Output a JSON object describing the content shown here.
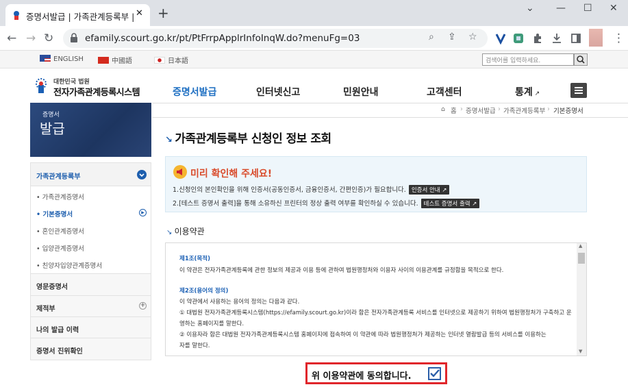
{
  "browser": {
    "tab_title": "증명서발급 | 가족관계등록부 | 진",
    "tab_close": "✕",
    "new_tab": "+",
    "url": "efamily.scourt.go.kr/pt/PtFrrpApplrInfoInqW.do?menuFg=03",
    "window_controls": [
      "⌄",
      "—",
      "☐",
      "✕"
    ]
  },
  "langbar": {
    "english": "ENGLISH",
    "chinese": "中國語",
    "japanese": "日本語",
    "search_placeholder": "검색어를 입력하세요."
  },
  "header": {
    "logo_sub": "대한민국 법원",
    "logo_main": "전자가족관계등록시스템",
    "nav": [
      "증명서발급",
      "인터넷신고",
      "민원안내",
      "고객센터",
      "통계"
    ],
    "active_nav_color": "#1e6fc2"
  },
  "banner": {
    "small": "증명서",
    "big": "발급"
  },
  "breadcrumb": [
    "홈",
    "증명서발급",
    "가족관계등록부",
    "기본증명서"
  ],
  "sidebar": {
    "section": "가족관계등록부",
    "items": [
      "가족관계증명서",
      "기본증명서",
      "혼인관계증명서",
      "입양관계증명서",
      "친양자입양관계증명서"
    ],
    "others": [
      "영문증명서",
      "제적부",
      "나의 발급 이력",
      "증명서 진위확인"
    ]
  },
  "page": {
    "title": "가족관계등록부 신청인 정보 조회",
    "notice_heading": "미리 확인해 주세요!",
    "notice_line1": "1.신청인의 본인확인을 위해 인증서(공동인증서, 금융인증서, 간편인증)가 필요합니다.",
    "notice_btn1": "인증서 안내",
    "notice_line2": "2.[테스트 증명서 출력]을 통해 소유하신 프린터의 정상 출력 여부를 확인하실 수 있습니다.",
    "notice_btn2": "테스트 증명서 출력",
    "terms_heading": "이용약관",
    "terms": [
      {
        "bold": true,
        "text": "제1조(목적)"
      },
      {
        "bold": false,
        "text": "이 약관은 전자가족관계등록에 관한 정보의 제공과 이용 등에 관하여 법원행정처와 이용자 사이의 이용관계를 규정함을 목적으로 한다."
      },
      {
        "bold": true,
        "text": "제2조(용어의 정의)"
      },
      {
        "bold": false,
        "text": "이 약관에서 사용하는 용어의 정의는 다음과 같다."
      },
      {
        "bold": false,
        "text": "① 대법원 전자가족관계등록시스템(https://efamily.scourt.go.kr)이라 함은 전자가족관계등록 서비스를 인터넷으로 제공하기 위하여 법원행정처가 구축하고 운"
      },
      {
        "bold": false,
        "text": "영하는 홈페이지를 말한다."
      },
      {
        "bold": false,
        "text": "② 이용자라 함은 대법원 전자가족관계등록시스템 홈페이지에 접속하여 이 약관에 따라 법원행정처가 제공하는 인터넷 열람발급 등의 서비스를 이용하는"
      },
      {
        "bold": false,
        "text": "자를 말한다."
      }
    ],
    "agree_label": "위 이용약관에 동의합니다.",
    "agree_checked": true
  }
}
